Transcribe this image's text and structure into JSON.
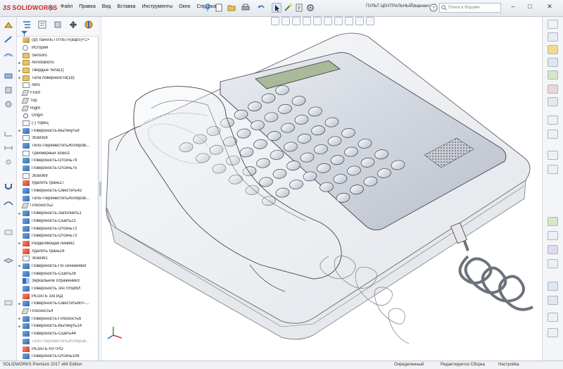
{
  "app": {
    "logo_prefix": "3S",
    "logo_name": "SOLIDWORKS",
    "document_title": "ПУЛЬТ ЦЕНТРАЛЬНЫЙ(вариант_5)",
    "search_placeholder": "Поиск в Форуме",
    "window_controls": [
      "–",
      "□",
      "✕"
    ]
  },
  "menu": [
    "Файл",
    "Правка",
    "Вид",
    "Вставка",
    "Инструменты",
    "Окно",
    "Справка"
  ],
  "toolbar_icons": [
    "new-file-icon",
    "open-icon",
    "save-icon",
    "print-icon",
    "undo-icon",
    "select-icon",
    "rebuild-icon",
    "options-icon"
  ],
  "feature_tree": {
    "rows": [
      {
        "label": "(ф) панель ПУЛЬТА(вар5)<1>",
        "icon": "root",
        "arrow": ""
      },
      {
        "label": "История",
        "icon": "hist",
        "arrow": ""
      },
      {
        "label": "Sensors",
        "icon": "folder",
        "arrow": ""
      },
      {
        "label": "Annotations",
        "icon": "folder",
        "arrow": "▸"
      },
      {
        "label": "Твердые тела(1)",
        "icon": "folder",
        "arrow": "▸"
      },
      {
        "label": "Тела поверхности(18)",
        "icon": "folder",
        "arrow": "▸"
      },
      {
        "label": "ABS",
        "icon": "sketch",
        "arrow": ""
      },
      {
        "label": "Front",
        "icon": "plane",
        "arrow": ""
      },
      {
        "label": "Top",
        "icon": "plane",
        "arrow": ""
      },
      {
        "label": "Right",
        "icon": "plane",
        "arrow": ""
      },
      {
        "label": "Origin",
        "icon": "origin",
        "arrow": ""
      },
      {
        "label": "(-) торец",
        "icon": "sketch",
        "arrow": ""
      },
      {
        "label": "Поверхность-Вытянуть8",
        "icon": "feat",
        "arrow": "▸"
      },
      {
        "label": "Эскиз58",
        "icon": "sketch",
        "arrow": ""
      },
      {
        "label": "Тело-Переместить/Копиров...",
        "icon": "feat",
        "arrow": ""
      },
      {
        "label": "Трехмерный эскиз1",
        "icon": "sketch",
        "arrow": ""
      },
      {
        "label": "Поверхность-Отсечь74",
        "icon": "feat",
        "arrow": ""
      },
      {
        "label": "Поверхность-Отсечь75",
        "icon": "feat",
        "arrow": ""
      },
      {
        "label": "Эскиз69",
        "icon": "sketch",
        "arrow": ""
      },
      {
        "label": "Удалить грань17",
        "icon": "red",
        "arrow": ""
      },
      {
        "label": "Поверхность-Сместить42",
        "icon": "feat",
        "arrow": ""
      },
      {
        "label": "Тело-Переместить/Копиров...",
        "icon": "feat",
        "arrow": ""
      },
      {
        "label": "Плоскость2",
        "icon": "plane",
        "arrow": ""
      },
      {
        "label": "Поверхность-Заполнить1",
        "icon": "feat",
        "arrow": "▸"
      },
      {
        "label": "Поверхность-Сшить21",
        "icon": "feat",
        "arrow": ""
      },
      {
        "label": "Поверхность-Отсечь72",
        "icon": "feat",
        "arrow": ""
      },
      {
        "label": "Поверхность-Отсечь73",
        "icon": "feat",
        "arrow": ""
      },
      {
        "label": "Разделяющая линия2",
        "icon": "red",
        "arrow": "▸"
      },
      {
        "label": "Удалить грань18",
        "icon": "red",
        "arrow": ""
      },
      {
        "label": "Эскиз61",
        "icon": "sketch",
        "arrow": ""
      },
      {
        "label": "Поверхность-По сечениям3",
        "icon": "feat",
        "arrow": "▸"
      },
      {
        "label": "Поверхность-Сшить26",
        "icon": "feat",
        "arrow": ""
      },
      {
        "label": "Зеркальное отражение3",
        "icon": "mirror",
        "arrow": ""
      },
      {
        "label": "Поверхность ЗАГЛУШКИ",
        "icon": "feat",
        "arrow": ""
      },
      {
        "label": "РЕЗАТЬ ЗАПАД",
        "icon": "red",
        "arrow": ""
      },
      {
        "label": "Поверхность-Сместить60<-...",
        "icon": "feat",
        "arrow": "▸"
      },
      {
        "label": "Плоскость4",
        "icon": "plane",
        "arrow": ""
      },
      {
        "label": "Поверхность-Плоскость6",
        "icon": "feat",
        "arrow": "▸"
      },
      {
        "label": "Поверхность-Вытянуть14",
        "icon": "feat",
        "arrow": "▸"
      },
      {
        "label": "Поверхность-Сшить44",
        "icon": "feat",
        "arrow": ""
      },
      {
        "label": "Тело-Переместить/Копиров...",
        "icon": "feat",
        "arrow": "",
        "dim": true
      },
      {
        "label": "РЕЗАТЬ НУТРО",
        "icon": "red",
        "arrow": ""
      },
      {
        "label": "Поверхность-Отсечь106",
        "icon": "feat",
        "arrow": ""
      }
    ]
  },
  "viewport": {
    "lcd_color": "#a9b99a",
    "body_color": "#dfe3ea",
    "key_rows": 8,
    "key_cols": 8
  },
  "status": {
    "edition": "SOLIDWORKS Premium 2017 x64 Edition",
    "state": "Определенный",
    "mode": "Редактируется Сборка",
    "settings": "Настройка"
  },
  "colors": {
    "accent": "#d3232b",
    "feature_blue": "#2f6bb8"
  }
}
